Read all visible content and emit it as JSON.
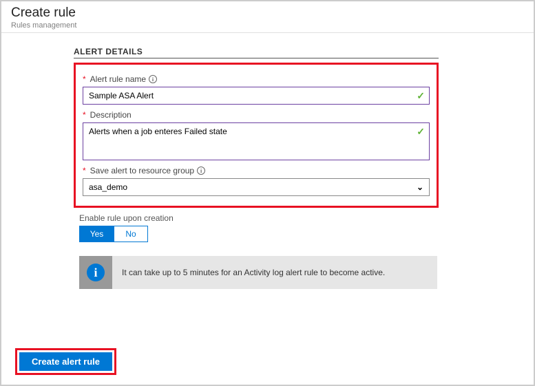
{
  "header": {
    "title": "Create rule",
    "subtitle": "Rules management"
  },
  "section": {
    "title": "ALERT DETAILS"
  },
  "fields": {
    "ruleName": {
      "label": "Alert rule name",
      "value": "Sample ASA Alert",
      "required": true,
      "hasInfo": true
    },
    "description": {
      "label": "Description",
      "value": "Alerts when a job enteres Failed state",
      "required": true,
      "hasInfo": false
    },
    "resourceGroup": {
      "label": "Save alert to resource group",
      "value": "asa_demo",
      "required": true,
      "hasInfo": true
    }
  },
  "enable": {
    "label": "Enable rule upon creation",
    "yes": "Yes",
    "no": "No",
    "selected": "Yes"
  },
  "infobox": {
    "message": "It can take up to 5 minutes for an Activity log alert rule to become active."
  },
  "footer": {
    "createButton": "Create alert rule"
  }
}
